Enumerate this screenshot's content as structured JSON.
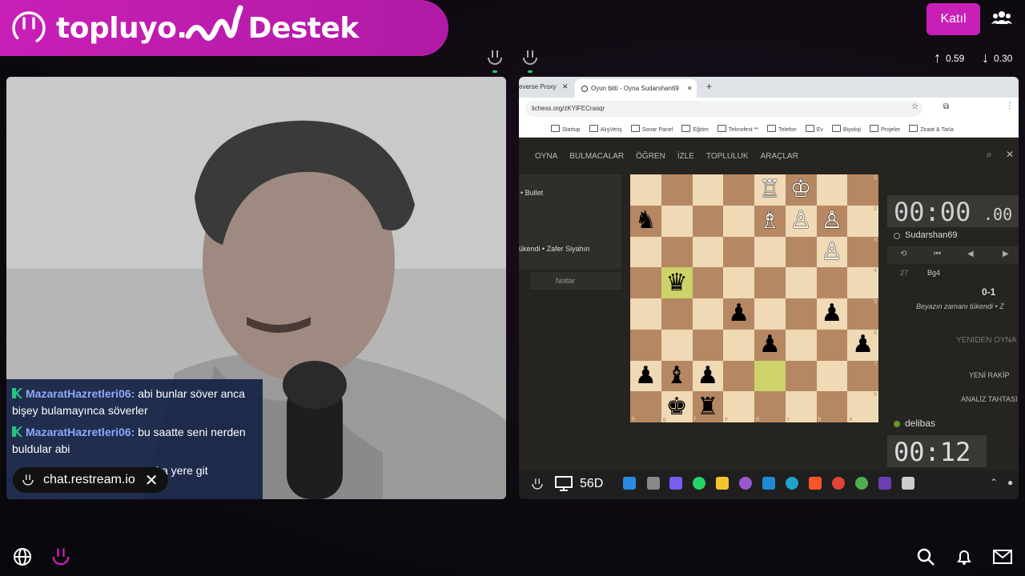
{
  "banner": {
    "text_left": "topluyo.",
    "text_right": "Destek"
  },
  "header": {
    "join_label": "Katıl",
    "upload_rate": "0.59",
    "download_rate": "0.30"
  },
  "chat": {
    "messages": [
      {
        "user": "MazaratHazretleri06:",
        "text": "abi bunlar söver anca bişey bulamayınca söverler"
      },
      {
        "user": "MazaratHazretleri06:",
        "text": "bu saatte seni nerden buldular abi"
      },
      {
        "user": "",
        "text": "ka yere git"
      }
    ],
    "source": "chat.restream.io"
  },
  "screen_share": {
    "label": "56D",
    "browser": {
      "tab1": "everse Proxy",
      "tab2": "Oyun bitti - Oyna Sudarshan69",
      "url": "lichess.org/zKYlFECrasqr",
      "bookmarks": [
        "Startup",
        "AlışVeriş",
        "Sonar Panel",
        "Eğitim",
        "Teknofest **",
        "Telefon",
        "Ev",
        "Biyoloji",
        "Projeler",
        "Ziraat & Tarla"
      ]
    },
    "lichess": {
      "nav": [
        "OYNA",
        "BULMACALAR",
        "ÖĞREN",
        "İZLE",
        "TOPLULUK",
        "ARAÇLAR"
      ],
      "game_type": "• Bullet",
      "game_result_left": "ükendi • Zafer Siyahın",
      "notes_tab": "Notlar",
      "top_player": "Sudarshan69",
      "top_clock": "00:00",
      "top_clock_tenths": ".00",
      "move_number": "27",
      "move": "Bg4",
      "score": "0-1",
      "result_text": "Beyazın zamanı tükendi • Z",
      "rematch": "YENİDEN OYNA",
      "new_opponent": "YENİ RAKİP",
      "analysis": "ANALİZ TAHTASI",
      "bottom_player": "delibas",
      "bottom_clock": "00:12",
      "board_rows": [
        [
          "",
          "",
          "",
          "",
          "R",
          "K",
          "",
          ""
        ],
        [
          "n",
          "",
          "",
          "",
          "B",
          "P",
          "P",
          ""
        ],
        [
          "",
          "",
          "",
          "",
          "",
          "",
          "P",
          ""
        ],
        [
          "",
          "q",
          "",
          "",
          "",
          "",
          "",
          ""
        ],
        [
          "",
          "",
          "",
          "p",
          "",
          "",
          "p",
          ""
        ],
        [
          "",
          "",
          "",
          "",
          "p",
          "",
          "",
          "p"
        ],
        [
          "p",
          "b",
          "p",
          "",
          "",
          "",
          "",
          ""
        ],
        [
          "",
          "k",
          "r",
          "",
          "",
          "",
          "",
          ""
        ]
      ],
      "rank_labels": [
        "1",
        "2",
        "3",
        "4",
        "5",
        "6",
        "7",
        "8"
      ],
      "file_labels": [
        "h",
        "g",
        "f",
        "e",
        "d",
        "c",
        "b",
        "a"
      ]
    }
  },
  "colors": {
    "brand": "#c81fb6",
    "chat_bg": "#142244",
    "board_light": "#f0d9b5",
    "board_dark": "#b58863"
  }
}
